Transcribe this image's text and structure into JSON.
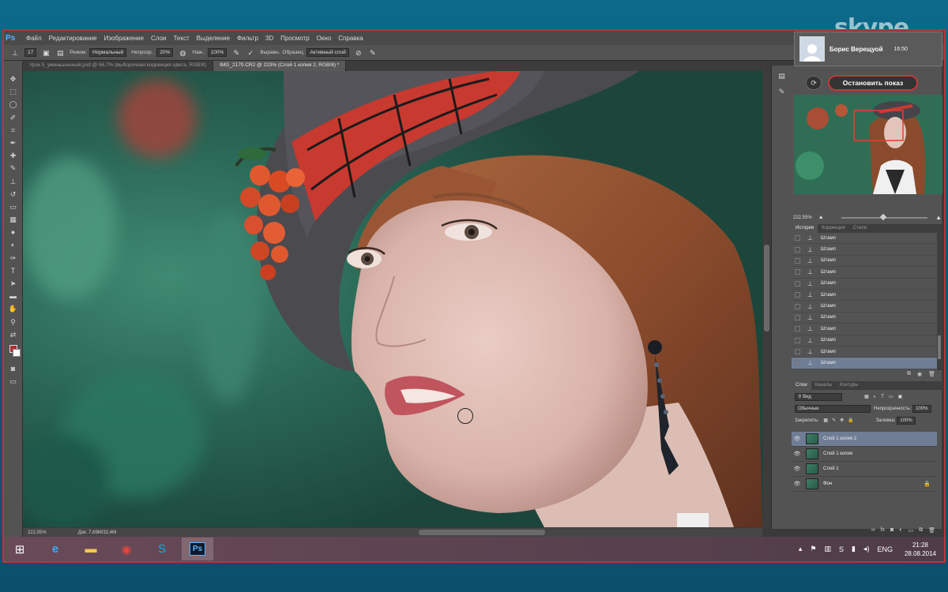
{
  "menubar": {
    "logo": "Ps",
    "items": [
      "Файл",
      "Редактирование",
      "Изображение",
      "Слои",
      "Текст",
      "Выделение",
      "Фильтр",
      "3D",
      "Просмотр",
      "Окно",
      "Справка"
    ]
  },
  "options": {
    "size": "17",
    "mode_label": "Режим:",
    "mode_value": "Нормальный",
    "opacity_label": "Непрозр.:",
    "opacity_value": "20%",
    "flow_label": "Наж.:",
    "flow_value": "100%",
    "aligned_label": "Выравн.",
    "sample_label": "Образец:",
    "sample_value": "Активный слой"
  },
  "tabs": [
    {
      "label": "Урок 5_уменьшенный.psd @ 66,7% (выборочная коррекция цвета, RGB/8)",
      "active": false
    },
    {
      "label": "IMG_2170.CR2 @ 223% (Слой 1 копия 2, RGB/8) *",
      "active": true
    }
  ],
  "status": {
    "zoom": "222,55%",
    "doc": "Док: 7,69М/32,4М"
  },
  "skype": {
    "logo_text": "skype",
    "caller_name": "Борис Верещуой",
    "call_time": "16:50",
    "stop_button": "Остановить показ"
  },
  "navigator": {
    "zoom": "222,55%"
  },
  "history_panel": {
    "tabs": [
      "История",
      "Коррекция",
      "Стили"
    ],
    "items": [
      "Штамп",
      "Штамп",
      "Штамп",
      "Штамп",
      "Штамп",
      "Штамп",
      "Штамп",
      "Штамп",
      "Штамп",
      "Штамп",
      "Штамп",
      "Штамп"
    ]
  },
  "layers_panel": {
    "tabs": [
      "Слои",
      "Каналы",
      "Контуры"
    ],
    "kind_label": "Вид",
    "blend_mode": "Обычные",
    "opacity_label": "Непрозрачность:",
    "opacity_value": "100%",
    "lock_label": "Закрепить:",
    "fill_label": "Заливка:",
    "fill_value": "100%",
    "layers": [
      "Слой 1 копия 2",
      "Слой 1 копия",
      "Слой 1",
      "Фон"
    ]
  },
  "taskbar": {
    "language": "ENG",
    "time": "21:28",
    "date": "28.08.2014"
  },
  "colors": {
    "frame_border": "#b8343a",
    "selection": "#6f7d95",
    "foreground_swatch": "#b42d2d"
  }
}
